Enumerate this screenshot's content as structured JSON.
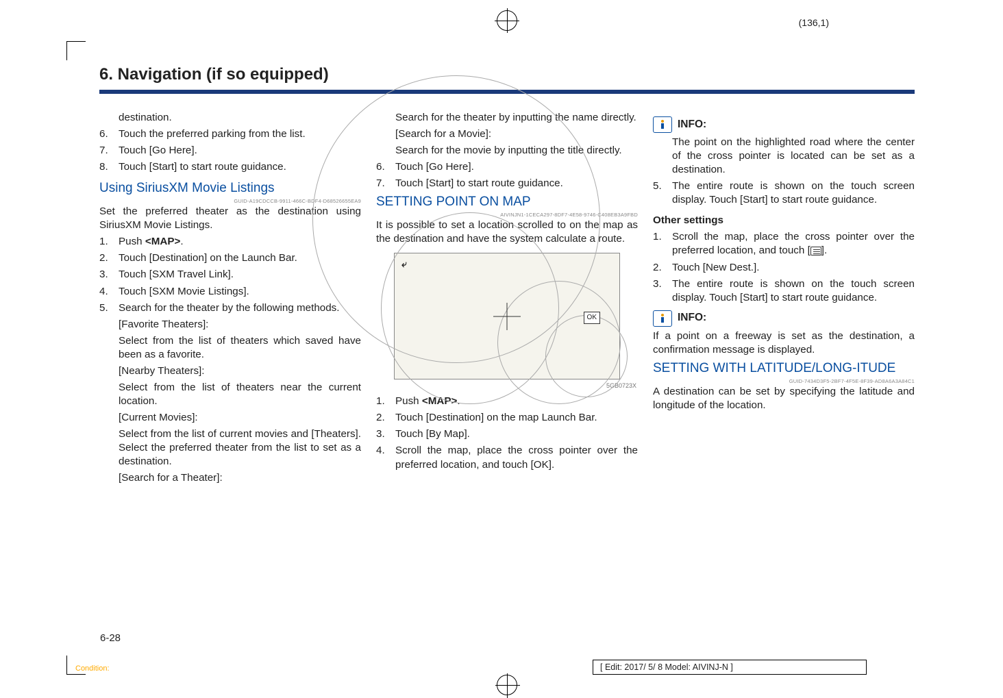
{
  "page_coord": "(136,1)",
  "section_title": "6. Navigation (if so equipped)",
  "col1": {
    "destination": "destination.",
    "i6": [
      "6.",
      "Touch the preferred parking from the list."
    ],
    "i7": [
      "7.",
      "Touch [Go Here]."
    ],
    "i8": [
      "8.",
      "Touch [Start] to start route guidance."
    ],
    "h_sirius": "Using SiriusXM Movie Listings",
    "guid_sirius": "GUID-A19CDCCB-9911-466C-BDF4-D68526655EA9",
    "p_sirius": "Set the preferred theater as the destination using SiriusXM Movie Listings.",
    "s1": [
      "1.",
      "Push ",
      "<MAP>",
      "."
    ],
    "s2": [
      "2.",
      "Touch [Destination] on the Launch Bar."
    ],
    "s3": [
      "3.",
      "Touch [SXM Travel Link]."
    ],
    "s4": [
      "4.",
      "Touch [SXM Movie Listings]."
    ],
    "s5": [
      "5.",
      "Search for the theater by the following methods."
    ],
    "fav_h": "[Favorite Theaters]:",
    "fav_p": "Select from the list of theaters which saved have been as a favorite.",
    "near_h": "[Nearby Theaters]:",
    "near_p": "Select from the list of theaters near the current location.",
    "cur_h": "[Current Movies]:",
    "cur_p": "Select from the list of current movies and [Theaters]. Select the preferred theater from the list to set as a destination.",
    "search_h": "[Search for a Theater]:"
  },
  "col2": {
    "theater_p": "Search for the theater by inputting the name directly.",
    "movie_h": "[Search for a Movie]:",
    "movie_p": "Search for the movie by inputting the title directly.",
    "i6": [
      "6.",
      "Touch [Go Here]."
    ],
    "i7": [
      "7.",
      "Touch [Start] to start route guidance."
    ],
    "h_setting": "SETTING POINT ON MAP",
    "guid_setting": "AIVINJN1-1CECA297-8DF7-4E58-9746-C408EB3A9FBD",
    "p_setting": "It is possible to set a location scrolled to on the map as the destination and have the system calculate a route.",
    "map_back": "⤶",
    "map_ok": "OK",
    "map_caption": "5GB0723X",
    "m1": [
      "1.",
      "Push ",
      "<MAP>",
      "."
    ],
    "m2": [
      "2.",
      "Touch [Destination] on the map Launch Bar."
    ],
    "m3": [
      "3.",
      "Touch [By Map]."
    ],
    "m4": [
      "4.",
      "Scroll the map, place the cross pointer over the preferred location, and touch [OK]."
    ]
  },
  "col3": {
    "info1_label": "INFO:",
    "info1_p": "The point on the highlighted road where the center of the cross pointer is located can be set as a destination.",
    "i5": [
      "5.",
      "The entire route is shown on the touch screen display. Touch [Start] to start route guidance."
    ],
    "other_h": "Other settings",
    "o1a": [
      "1.",
      "Scroll the map, place the cross pointer over the preferred location, and touch ["
    ],
    "o1b": "].",
    "o2": [
      "2.",
      "Touch [New Dest.]."
    ],
    "o3": [
      "3.",
      "The entire route is shown on the touch screen display. Touch [Start] to start route guidance."
    ],
    "info2_label": "INFO:",
    "info2_p": "If a point on a freeway is set as the destination, a confirmation message is displayed.",
    "h_latlon": "SETTING WITH LATITUDE/LONG-ITUDE",
    "guid_latlon": "GUID-7434D3F5-2BF7-4F5E-8F39-AD8A6A3A84C1",
    "p_latlon": "A destination can be set by specifying the latitude and longitude of the location."
  },
  "page_num": "6-28",
  "condition": "Condition:",
  "edit_box": "[ Edit: 2017/ 5/ 8   Model: AIVINJ-N ]"
}
